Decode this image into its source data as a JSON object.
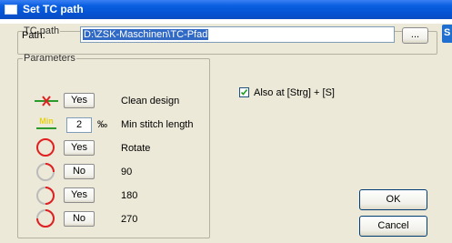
{
  "window": {
    "title": "Set TC path"
  },
  "tc_path": {
    "legend": "TC path",
    "path_label": "Path:",
    "path_value": "D:\\ZSK-Maschinen\\TC-Pfad",
    "browse_label": "..."
  },
  "parameters": {
    "legend": "Parameters",
    "rows": [
      {
        "icon": "clean-design-icon",
        "control": "Yes",
        "label": "Clean design"
      },
      {
        "icon": "min-stitch-icon",
        "icon_text": "Min",
        "control": "2",
        "unit": "‰",
        "label": "Min stitch length"
      },
      {
        "icon": "rotate-icon",
        "control": "Yes",
        "label": "Rotate"
      },
      {
        "icon": "rotate-90-icon",
        "control": "No",
        "label": "90"
      },
      {
        "icon": "rotate-180-icon",
        "control": "Yes",
        "label": "180"
      },
      {
        "icon": "rotate-270-icon",
        "control": "No",
        "label": "270"
      }
    ]
  },
  "also_at": {
    "checked": true,
    "label": "Also at [Strg] + [S]"
  },
  "buttons": {
    "ok": "OK",
    "cancel": "Cancel"
  },
  "colors": {
    "title_bar": "#0a5fe0",
    "icon_red": "#e02020",
    "icon_green": "#2c9a2c",
    "icon_yellow": "#e6d21a"
  }
}
